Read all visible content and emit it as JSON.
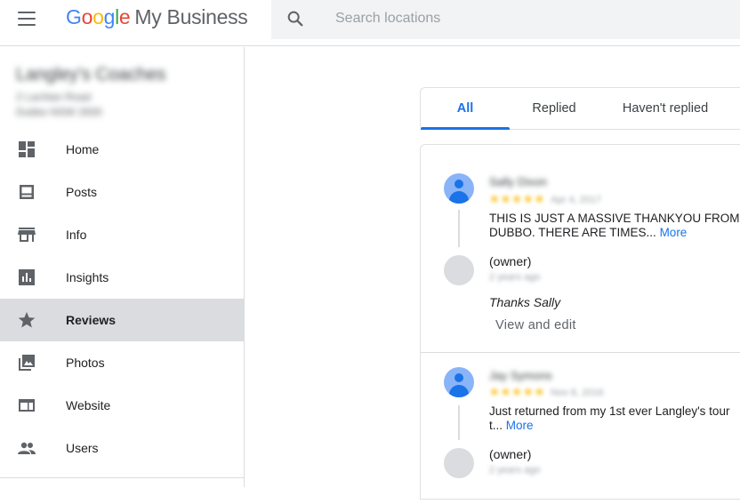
{
  "header": {
    "logo": {
      "g1": "G",
      "o1": "o",
      "o2": "o",
      "g2": "g",
      "l": "l",
      "e": "e"
    },
    "product": "My Business",
    "search_placeholder": "Search locations"
  },
  "sidebar": {
    "business": {
      "name": "Langley's Coaches",
      "address_line1": "2 Lachlan Road",
      "address_line2": "Dubbo NSW 2830"
    },
    "items": [
      {
        "label": "Home",
        "icon": "dashboard-icon"
      },
      {
        "label": "Posts",
        "icon": "posts-icon"
      },
      {
        "label": "Info",
        "icon": "store-icon"
      },
      {
        "label": "Insights",
        "icon": "bar-chart-icon"
      },
      {
        "label": "Reviews",
        "icon": "star-icon",
        "active": true
      },
      {
        "label": "Photos",
        "icon": "photos-icon"
      },
      {
        "label": "Website",
        "icon": "website-icon"
      },
      {
        "label": "Users",
        "icon": "users-icon"
      }
    ]
  },
  "tabs": [
    {
      "label": "All",
      "active": true
    },
    {
      "label": "Replied"
    },
    {
      "label": "Haven't replied"
    }
  ],
  "reviews": [
    {
      "name": "Sally Dixon",
      "stars": "★★★★★",
      "date": "Apr 4, 2017",
      "text_line1": "THIS IS JUST A MASSIVE THANKYOU FROM A",
      "text_line2": "DUBBO. THERE ARE TIMES...",
      "more": "More",
      "owner_label": "(owner)",
      "owner_time": "2 years ago",
      "reply": "Thanks Sally",
      "view_edit": "View and edit"
    },
    {
      "name": "Jay Symons",
      "stars": "★★★★★",
      "date": "Nov 8, 2016",
      "text_line1": "Just returned from my 1st ever Langley's tour",
      "text_line2": "t...",
      "more": "More",
      "owner_label": "(owner)",
      "owner_time": "2 years ago"
    }
  ],
  "colors": {
    "accent": "#1a73e8",
    "active_nav": "#dadce0",
    "star": "#fbbc04"
  }
}
